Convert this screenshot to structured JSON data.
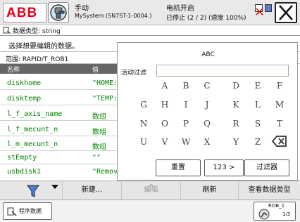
{
  "statusbar": {
    "mode": "手动",
    "system": "MySystem (SN7ST-1-0004.)",
    "motor": "电机开启",
    "state": "已停止 (2 / 2) (速度 100%)"
  },
  "header": {
    "data_type": "数据类型: string",
    "prompt": "选择想要编辑的数据。",
    "scope": "范围: RAPID/T_ROB1"
  },
  "table": {
    "columns": [
      "名称",
      "值"
    ],
    "rows": [
      {
        "name": "diskhome",
        "value": "\"HOME:"
      },
      {
        "name": "disktemp",
        "value": "\"TEMP:"
      },
      {
        "name": "l_f_axis_name",
        "value": "数组"
      },
      {
        "name": "l_f_mecunt_n",
        "value": "数组"
      },
      {
        "name": "l_m_mecunt_n",
        "value": "数组"
      },
      {
        "name": "stEmpty",
        "value": "\"\""
      },
      {
        "name": "usbdisk1",
        "value": "\"Remove"
      }
    ]
  },
  "keyboard": {
    "title": "ABC",
    "filter_label": "活动过滤",
    "filter_value": "",
    "keys": [
      "A",
      "B",
      "C",
      "D",
      "E",
      "F",
      "G",
      "H",
      "I",
      "J",
      "K",
      "L",
      "M",
      "N",
      "O",
      "P",
      "Q",
      "R",
      "S",
      "T",
      "U",
      "V",
      "W",
      "X",
      "Y",
      "Z"
    ],
    "reset_label": "重置",
    "mode_label": "123 >",
    "filter_button_label": "过滤器"
  },
  "commands": {
    "new_label": "新建...",
    "edit_label": "编辑",
    "refresh_label": "刷新",
    "view_type_label": "查看数据类型"
  },
  "taskbar": {
    "program_data_label": "程序数据",
    "robot_label": "ROB_1",
    "robot_sub": "1/3"
  },
  "colors": {
    "abb_red": "#e2001a",
    "data_green": "#008000",
    "header_gray": "#666666"
  }
}
